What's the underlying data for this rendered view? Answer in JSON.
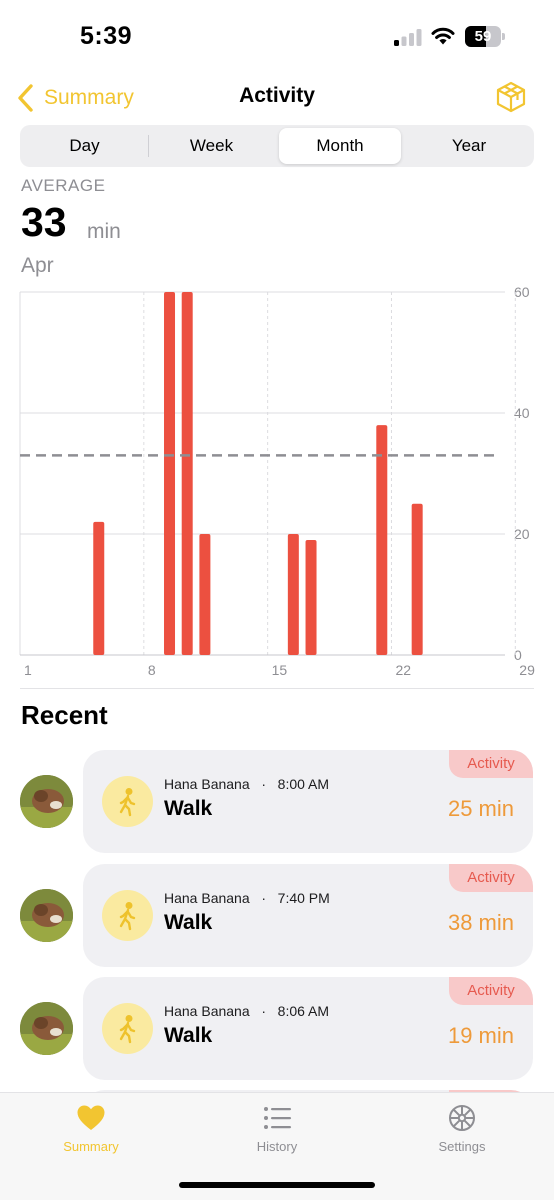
{
  "status_bar": {
    "time": "5:39",
    "battery": "59",
    "battery_level": 0.59
  },
  "nav": {
    "back_label": "Summary",
    "title": "Activity",
    "accent_color": "#f2c531"
  },
  "segments": {
    "day": "Day",
    "week": "Week",
    "month": "Month",
    "year": "Year",
    "selected": "Month"
  },
  "summary": {
    "label": "AVERAGE",
    "value": "33",
    "unit": "min",
    "period": "Apr"
  },
  "chart_data": {
    "type": "bar",
    "x": [
      5,
      9,
      10,
      11,
      16,
      17,
      21,
      23
    ],
    "values": [
      22,
      60,
      60,
      20,
      20,
      19,
      38,
      25
    ],
    "average": 33,
    "xlim": [
      1,
      30
    ],
    "ylim": [
      0,
      60
    ],
    "x_ticks": [
      "1",
      "8",
      "15",
      "22",
      "29"
    ],
    "y_ticks": [
      "0",
      "20",
      "40",
      "60"
    ],
    "bar_color": "#ec5040",
    "average_line_color": "#8e8e93",
    "grid": true
  },
  "recent": {
    "title": "Recent",
    "items": [
      {
        "name": "Hana Banana",
        "sep": "·",
        "time": "8:00 AM",
        "activity": "Walk",
        "duration": "25 min",
        "badge": "Activity",
        "icon": "walk-icon"
      },
      {
        "name": "Hana Banana",
        "sep": "·",
        "time": "7:40 PM",
        "activity": "Walk",
        "duration": "38 min",
        "badge": "Activity",
        "icon": "walk-icon"
      },
      {
        "name": "Hana Banana",
        "sep": "·",
        "time": "8:06 AM",
        "activity": "Walk",
        "duration": "19 min",
        "badge": "Activity",
        "icon": "walk-icon"
      }
    ]
  },
  "tab_bar": {
    "summary": "Summary",
    "history": "History",
    "settings": "Settings",
    "active": "Summary"
  }
}
